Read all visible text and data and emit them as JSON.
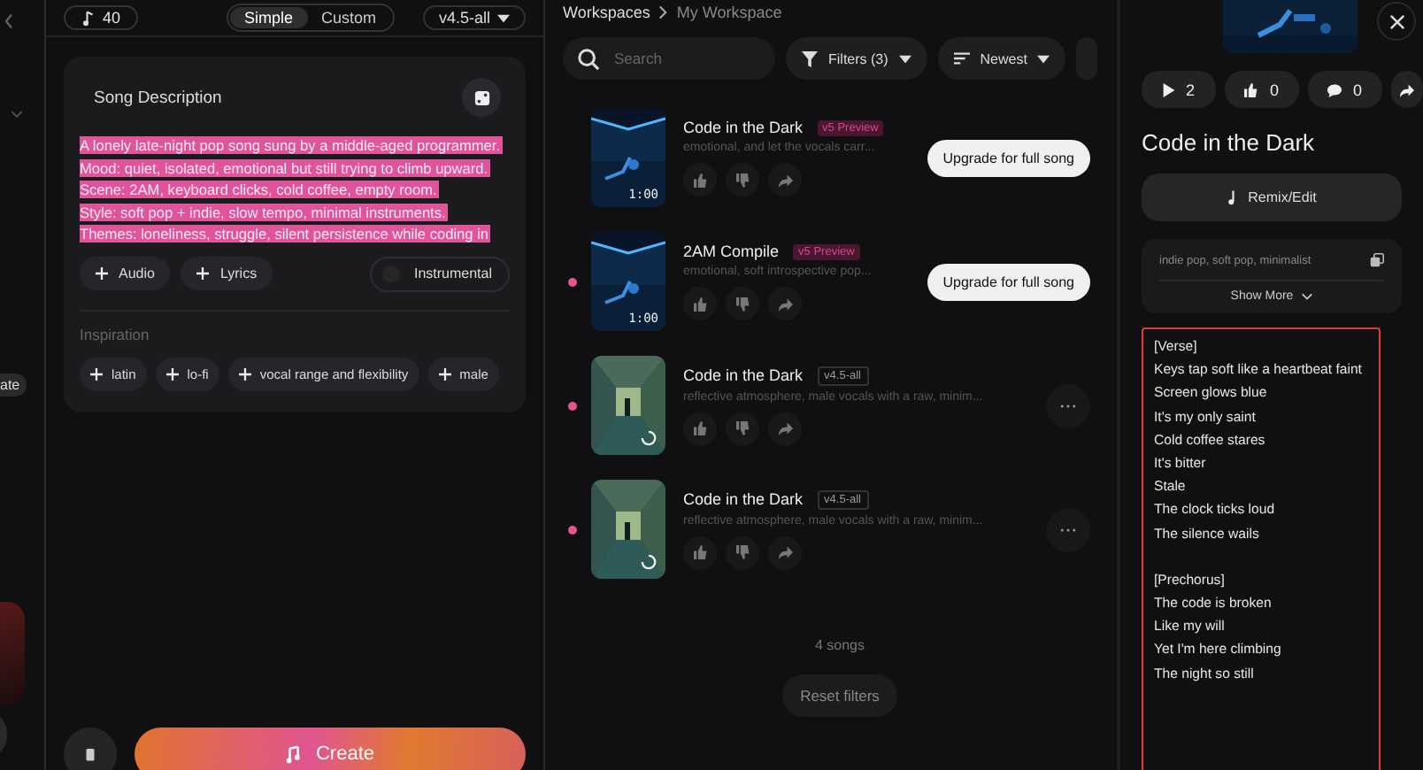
{
  "rail": {
    "chip_label": "ate"
  },
  "create": {
    "credits": "40",
    "modes": [
      {
        "label": "Simple",
        "selected": true
      },
      {
        "label": "Custom",
        "selected": false
      }
    ],
    "model": "v4.5-all",
    "description_label": "Song Description",
    "description_lines": [
      {
        "text": "A lonely late-night pop song sung by a middle-aged programmer.",
        "selected": true
      },
      {
        "text": "Mood: quiet, isolated, emotional but still trying to climb upward.",
        "selected": true
      },
      {
        "text": "Scene: 2AM, keyboard clicks, cold coffee, empty room.",
        "selected": true
      },
      {
        "text": "Style: soft  pop + indie, slow tempo, minimal instruments.",
        "selected": true
      },
      {
        "text": "Themes: loneliness, struggle, silent persistence while coding in",
        "selected": true
      }
    ],
    "add_buttons": [
      "Audio",
      "Lyrics"
    ],
    "instrumental": {
      "label": "Instrumental",
      "on": false
    },
    "inspiration_label": "Inspiration",
    "inspiration_tags": [
      "latin",
      "lo-fi",
      "vocal range and flexibility",
      "male"
    ],
    "create_label": "Create"
  },
  "workspace": {
    "breadcrumb": [
      "Workspaces",
      "My Workspace"
    ],
    "search": {
      "placeholder": "Search"
    },
    "filters_label": "Filters (3)",
    "sort_label": "Newest",
    "songs": [
      {
        "kind": "preview",
        "title": "Code in the Dark",
        "badge": "v5 Preview",
        "description": "emotional, and let the vocals carr...",
        "duration": "1:00",
        "loading": false,
        "unread": false,
        "action": {
          "kind": "upgrade",
          "label": "Upgrade for full song"
        }
      },
      {
        "kind": "preview",
        "title": "2AM Compile",
        "badge": "v5 Preview",
        "description": "emotional, soft introspective pop...",
        "duration": "1:00",
        "loading": false,
        "unread": true,
        "action": {
          "kind": "upgrade",
          "label": "Upgrade for full song"
        }
      },
      {
        "kind": "version",
        "title": "Code in the Dark",
        "badge": "v4.5-all",
        "description": "reflective atmosphere, male vocals with a raw, minim...",
        "loading": true,
        "unread": true,
        "action": {
          "kind": "more"
        }
      },
      {
        "kind": "version",
        "title": "Code in the Dark",
        "badge": "v4.5-all",
        "description": "reflective atmosphere, male vocals with a raw, minim...",
        "loading": true,
        "unread": true,
        "action": {
          "kind": "more"
        }
      }
    ],
    "count": "4 songs",
    "reset_label": "Reset filters"
  },
  "detail": {
    "stats": [
      {
        "kind": "play",
        "value": "2"
      },
      {
        "kind": "like",
        "value": "0"
      },
      {
        "kind": "comment",
        "value": "0"
      },
      {
        "kind": "share"
      }
    ],
    "title": "Code in the Dark",
    "remix_label": "Remix/Edit",
    "tags": "indie pop, soft pop, minimalist",
    "show_more": "Show More",
    "lyrics": [
      {
        "lines": [
          "[Verse]",
          "Keys tap soft like a heartbeat faint",
          "Screen glows blue",
          "It's my only saint",
          "Cold coffee stares",
          "It's bitter",
          "Stale",
          "The clock ticks loud",
          "The silence wails"
        ]
      },
      {
        "lines": [
          "[Prechorus]",
          "The code is broken",
          "Like my will",
          "Yet I'm here climbing",
          "The night so still"
        ]
      }
    ]
  }
}
